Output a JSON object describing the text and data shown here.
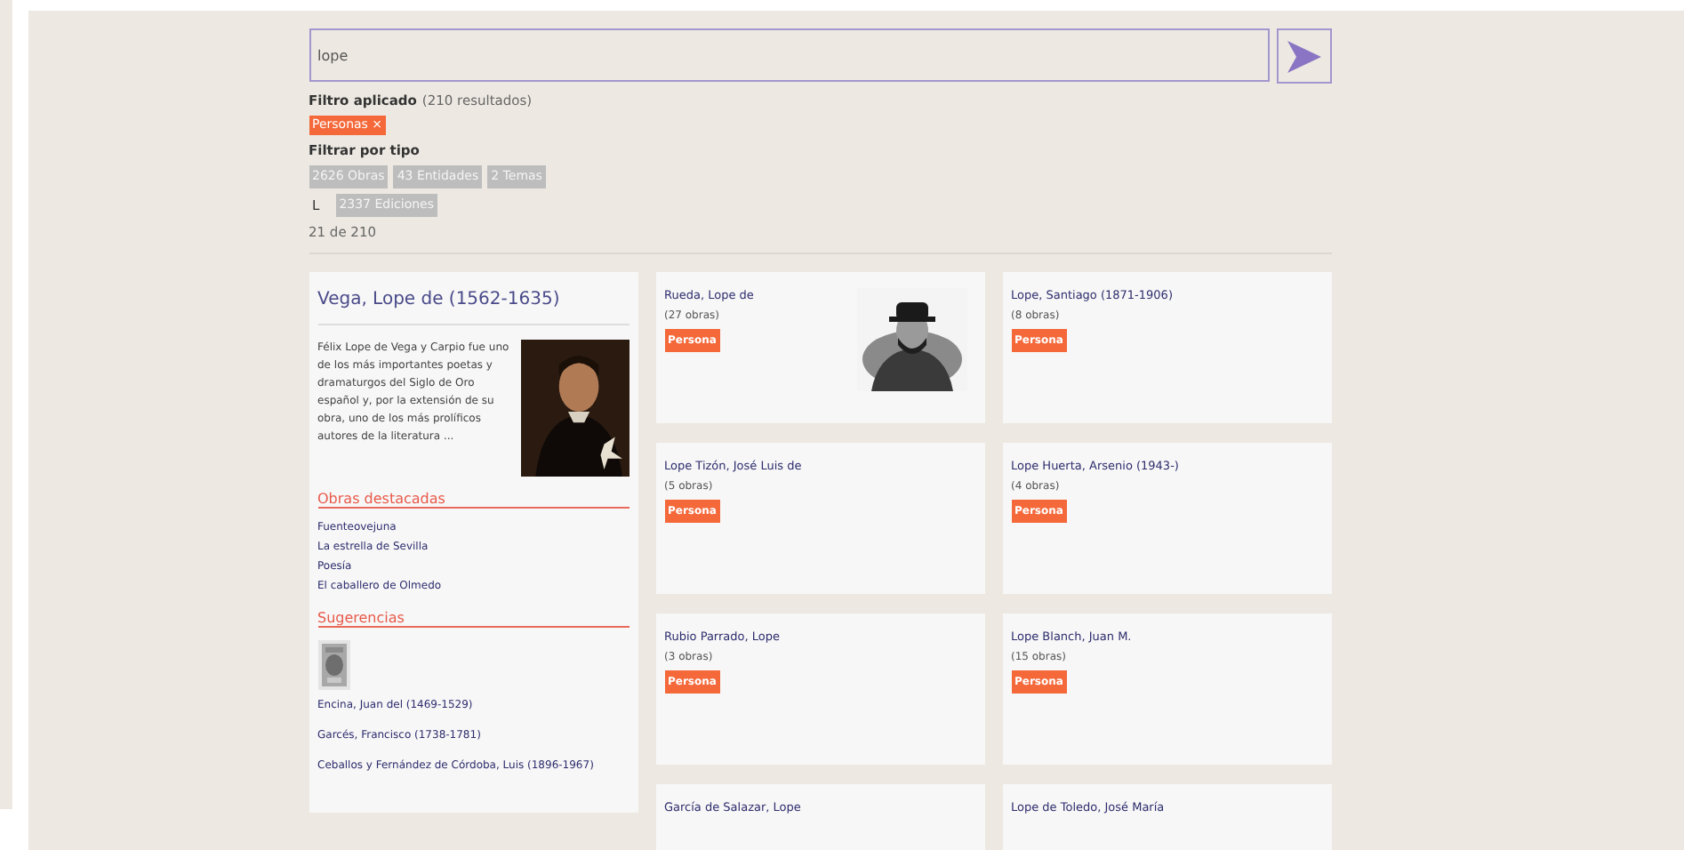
{
  "search": {
    "value": "lope"
  },
  "filter_applied": {
    "label": "Filtro aplicado",
    "count": "(210 resultados)",
    "tags": [
      "Personas ×"
    ]
  },
  "filter_by_type": {
    "label": "Filtrar por tipo",
    "chips": [
      "2626 Obras",
      "43 Entidades",
      "2 Temas"
    ],
    "letter": "L",
    "letter_chips": [
      "2337 Ediciones"
    ]
  },
  "pagination": "21 de 210",
  "featured": {
    "title": "Vega, Lope de (1562-1635)",
    "description": "Félix Lope de Vega y Carpio fue uno de los más importantes poetas y dramaturgos del Siglo de Oro español y, por la extensión de su obra, uno de los más prolíficos autores de la literatura ...",
    "works_heading": "Obras destacadas",
    "works": [
      "Fuenteovejuna",
      "La estrella de Sevilla",
      "Poesía",
      "El caballero de Olmedo"
    ],
    "suggestions_heading": "Sugerencias",
    "suggestions": [
      {
        "name": "Encina, Juan del (1469-1529)"
      },
      {
        "name": "Garcés, Francisco (1738-1781)"
      },
      {
        "name": "Ceballos y Fernández de Córdoba, Luis (1896-1967)"
      }
    ]
  },
  "results": [
    {
      "name": "Rueda, Lope de",
      "count": "(27 obras)",
      "tag": "Persona"
    },
    {
      "name": "Lope, Santiago (1871-1906)",
      "count": "(8 obras)",
      "tag": "Persona"
    },
    {
      "name": "Lope Tizón, José Luis de",
      "count": "(5 obras)",
      "tag": "Persona"
    },
    {
      "name": "Lope Huerta, Arsenio (1943-)",
      "count": "(4 obras)",
      "tag": "Persona"
    },
    {
      "name": "Rubio Parrado, Lope",
      "count": "(3 obras)",
      "tag": "Persona"
    },
    {
      "name": "Lope Blanch, Juan M.",
      "count": "(15 obras)",
      "tag": "Persona"
    },
    {
      "name": "García de Salazar, Lope"
    },
    {
      "name": "Lope de Toledo, José María"
    }
  ]
}
